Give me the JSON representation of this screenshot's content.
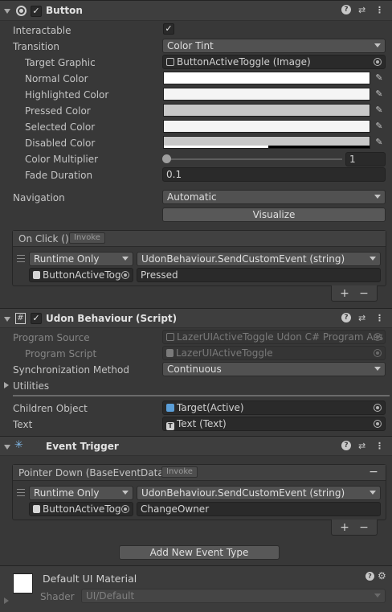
{
  "button_component": {
    "title": "Button",
    "interactable_label": "Interactable",
    "transition_label": "Transition",
    "transition_value": "Color Tint",
    "target_graphic_label": "Target Graphic",
    "target_graphic_value": "ButtonActiveToggle (Image)",
    "colors": [
      {
        "label": "Normal Color",
        "color": "#ffffff"
      },
      {
        "label": "Highlighted Color",
        "color": "#f5f5f5"
      },
      {
        "label": "Pressed Color",
        "color": "#c8c8c8"
      },
      {
        "label": "Selected Color",
        "color": "#f5f5f5"
      },
      {
        "label": "Disabled Color",
        "color": "#c8c8c8"
      }
    ],
    "color_multiplier_label": "Color Multiplier",
    "color_multiplier_value": "1",
    "color_multiplier_fraction": 0.0,
    "fade_duration_label": "Fade Duration",
    "fade_duration_value": "0.1",
    "navigation_label": "Navigation",
    "navigation_value": "Automatic",
    "visualize_label": "Visualize",
    "on_click": {
      "header": "On Click ()",
      "invoke_label": "Invoke",
      "runtime": "Runtime Only",
      "function": "UdonBehaviour.SendCustomEvent (string)",
      "object": "ButtonActiveTog",
      "argument": "Pressed",
      "plus": "+",
      "minus": "−"
    }
  },
  "udon_component": {
    "title": "Udon Behaviour (Script)",
    "program_source_label": "Program Source",
    "program_source_value": "LazerUIActiveToggle Udon C# Program Ass",
    "program_script_label": "Program Script",
    "program_script_value": "LazerUIActiveToggle",
    "sync_label": "Synchronization Method",
    "sync_value": "Continuous",
    "utilities_label": "Utilities",
    "children_label": "Children Object",
    "children_value": "Target(Active)",
    "text_label": "Text",
    "text_value": "Text (Text)"
  },
  "event_trigger": {
    "title": "Event Trigger",
    "entry_header": "Pointer Down (BaseEventData)",
    "invoke_label": "Invoke",
    "remove": "−",
    "runtime": "Runtime Only",
    "function": "UdonBehaviour.SendCustomEvent (string)",
    "object": "ButtonActiveTog",
    "argument": "ChangeOwner",
    "plus": "+",
    "minus": "−",
    "add_label": "Add New Event Type"
  },
  "material": {
    "name": "Default UI Material",
    "shader_label": "Shader",
    "shader_value": "UI/Default"
  }
}
